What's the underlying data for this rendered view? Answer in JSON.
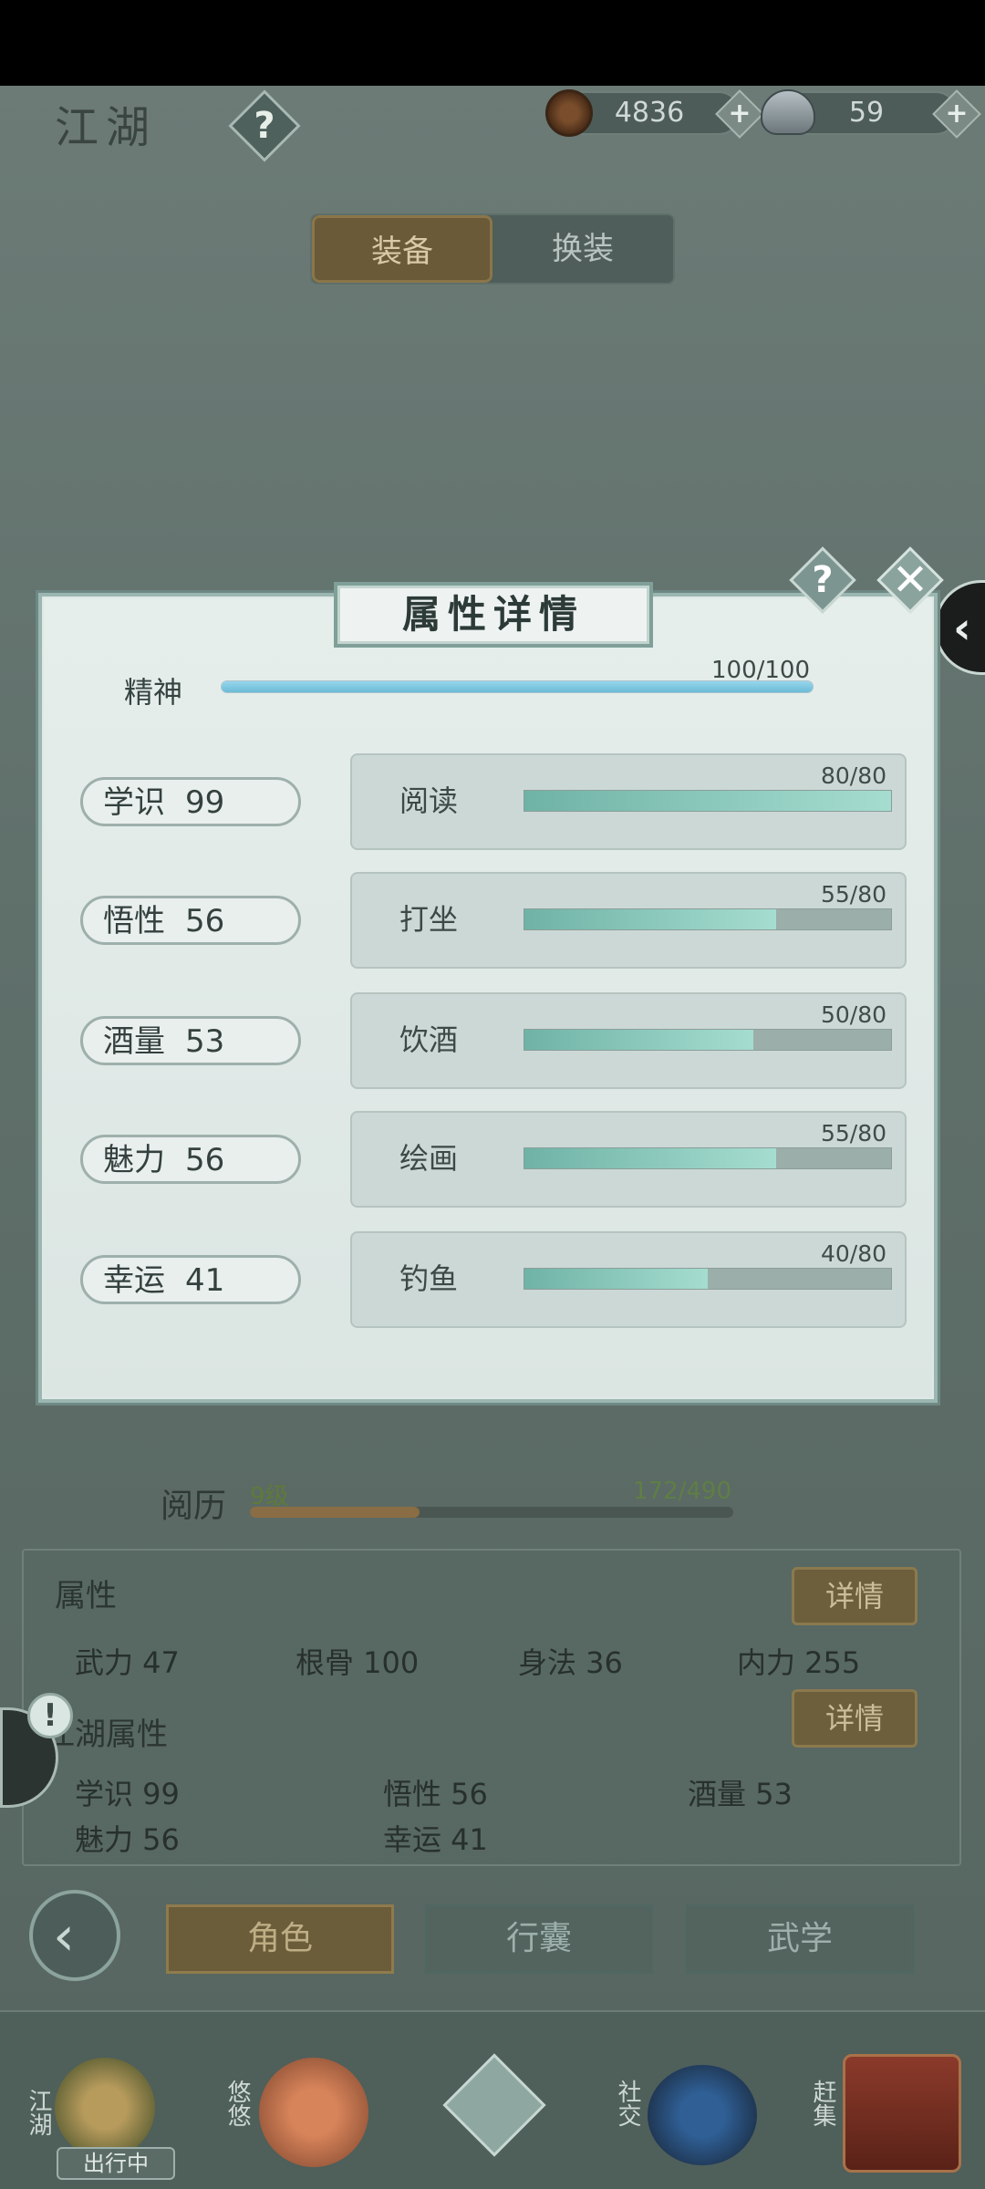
{
  "header": {
    "title": "江湖",
    "help_glyph": "?",
    "copper": {
      "icon": "coin-icon",
      "value": "4836"
    },
    "silver": {
      "icon": "silver-ingot-icon",
      "value": "59"
    },
    "plus_glyph": "+"
  },
  "tabs": [
    {
      "label": "装备",
      "active": true
    },
    {
      "label": "换装",
      "active": false
    }
  ],
  "modal": {
    "title": "属性详情",
    "help_glyph": "?",
    "close_glyph": "✕",
    "spirit": {
      "label": "精神",
      "value": "100/100",
      "fraction": 1.0
    },
    "rows": [
      {
        "attr": "学识",
        "attr_value": "99",
        "skill": "阅读",
        "skill_value": "80/80",
        "fraction": 1.0
      },
      {
        "attr": "悟性",
        "attr_value": "56",
        "skill": "打坐",
        "skill_value": "55/80",
        "fraction": 0.6875
      },
      {
        "attr": "酒量",
        "attr_value": "53",
        "skill": "饮酒",
        "skill_value": "50/80",
        "fraction": 0.625
      },
      {
        "attr": "魅力",
        "attr_value": "56",
        "skill": "绘画",
        "skill_value": "55/80",
        "fraction": 0.6875
      },
      {
        "attr": "幸运",
        "attr_value": "41",
        "skill": "钓鱼",
        "skill_value": "40/80",
        "fraction": 0.5
      }
    ]
  },
  "side_tab_glyph": "‹",
  "experience": {
    "label": "阅历",
    "level": "9级",
    "value": "172/490",
    "fraction": 0.351
  },
  "attributes_panel": {
    "title": "属性",
    "detail_label": "详情",
    "stats": [
      {
        "text": "武力  47"
      },
      {
        "text": "根骨  100"
      },
      {
        "text": "身法  36"
      },
      {
        "text": "内力  255"
      }
    ]
  },
  "jianghu_panel": {
    "title": "江湖属性",
    "detail_label": "详情",
    "stats": [
      {
        "text": "学识  99"
      },
      {
        "text": "悟性  56"
      },
      {
        "text": "酒量  53"
      },
      {
        "text": "魅力  56"
      },
      {
        "text": "幸运  41"
      }
    ]
  },
  "alert_glyph": "!",
  "back_glyph": "‹",
  "bottom_tabs": [
    {
      "label": "角色",
      "active": true
    },
    {
      "label": "行囊",
      "active": false
    },
    {
      "label": "武学",
      "active": false
    }
  ],
  "nav": [
    {
      "label": "江湖",
      "badge": "出行中",
      "icon": "jianghu-icon"
    },
    {
      "label": "悠悠",
      "icon": "swallow-icon"
    },
    {
      "label": "",
      "icon": "compass-star-icon"
    },
    {
      "label": "社交",
      "icon": "wave-icon"
    },
    {
      "label": "赶集",
      "icon": "market-basket-icon"
    }
  ]
}
